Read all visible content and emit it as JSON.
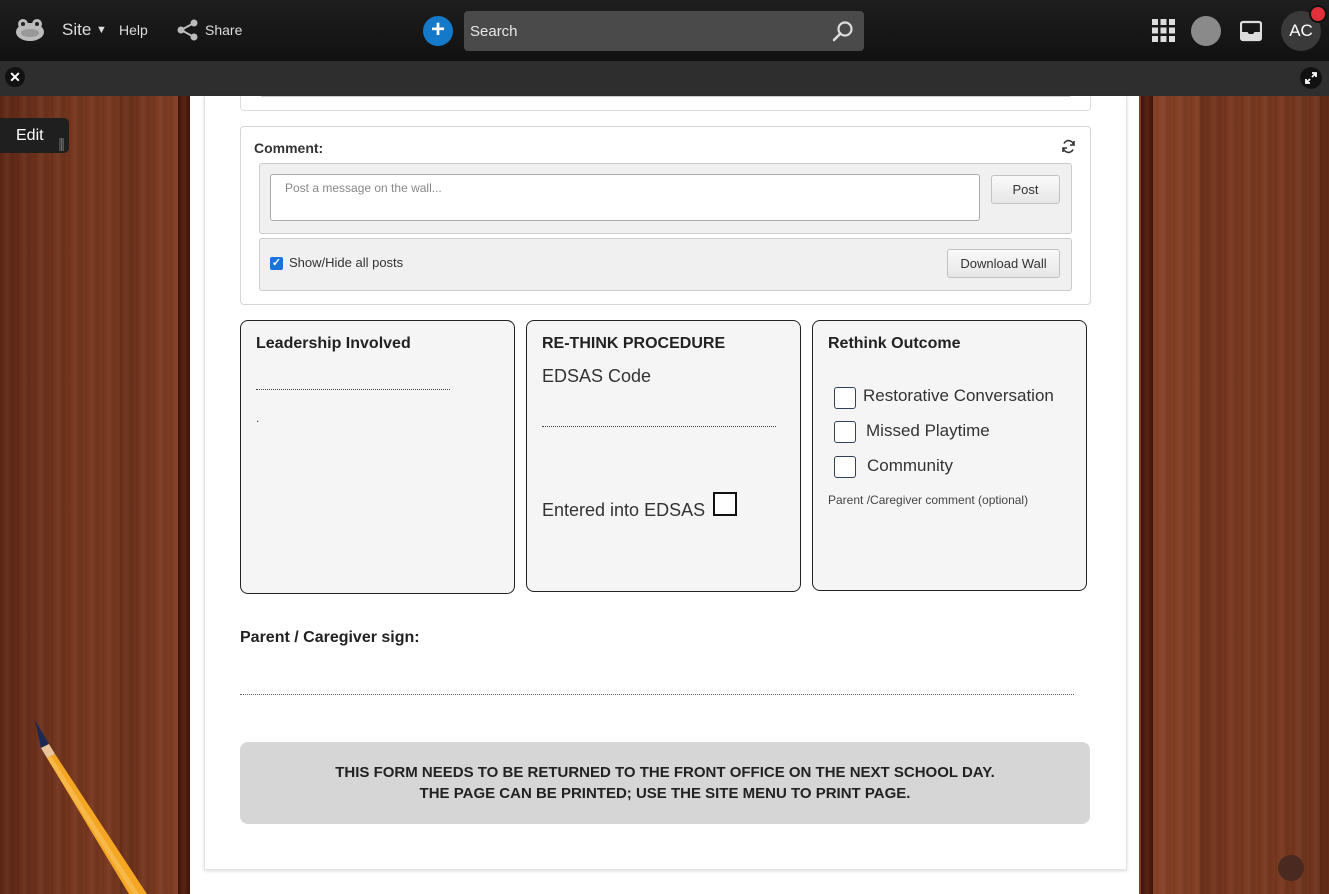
{
  "topbar": {
    "site_label": "Site",
    "help_label": "Help",
    "share_label": "Share",
    "search_placeholder": "Search",
    "avatar_initials": "AC"
  },
  "sidebar": {
    "edit_label": "Edit"
  },
  "comment": {
    "title": "Comment:",
    "placeholder": "Post a message on the wall...",
    "post_label": "Post",
    "show_hide_label": "Show/Hide all posts",
    "show_hide_checked": true,
    "download_label": "Download Wall"
  },
  "leadership": {
    "title": "Leadership Involved",
    "note": "."
  },
  "rethink_procedure": {
    "title": "RE-THINK PROCEDURE",
    "code_label": "EDSAS Code",
    "entered_label": "Entered into EDSAS"
  },
  "rethink_outcome": {
    "title": "Rethink Outcome",
    "options": [
      {
        "label": "Restorative Conversation",
        "checked": false
      },
      {
        "label": "Missed Playtime",
        "checked": false
      },
      {
        "label": "Community",
        "checked": false
      }
    ],
    "note": "Parent /Caregiver comment (optional)"
  },
  "sign": {
    "label": "Parent / Caregiver sign:"
  },
  "notice": {
    "line1": "THIS FORM NEEDS TO BE RETURNED TO THE FRONT OFFICE ON THE NEXT SCHOOL DAY.",
    "line2": "THE PAGE CAN BE PRINTED; USE THE SITE MENU TO PRINT PAGE."
  },
  "colors": {
    "accent_blue": "#1479c9",
    "checkbox_blue": "#1a73d9",
    "notification_red": "#e0303a",
    "notice_bg": "#d6d6d6"
  },
  "icons": [
    "frog-logo-icon",
    "caret-down-icon",
    "share-icon",
    "plus-icon",
    "search-icon",
    "apps-grid-icon",
    "inbox-icon",
    "notification-icon",
    "close-icon",
    "expand-icon",
    "refresh-icon",
    "check-icon",
    "pencil-icon",
    "frog-mini-icon"
  ]
}
